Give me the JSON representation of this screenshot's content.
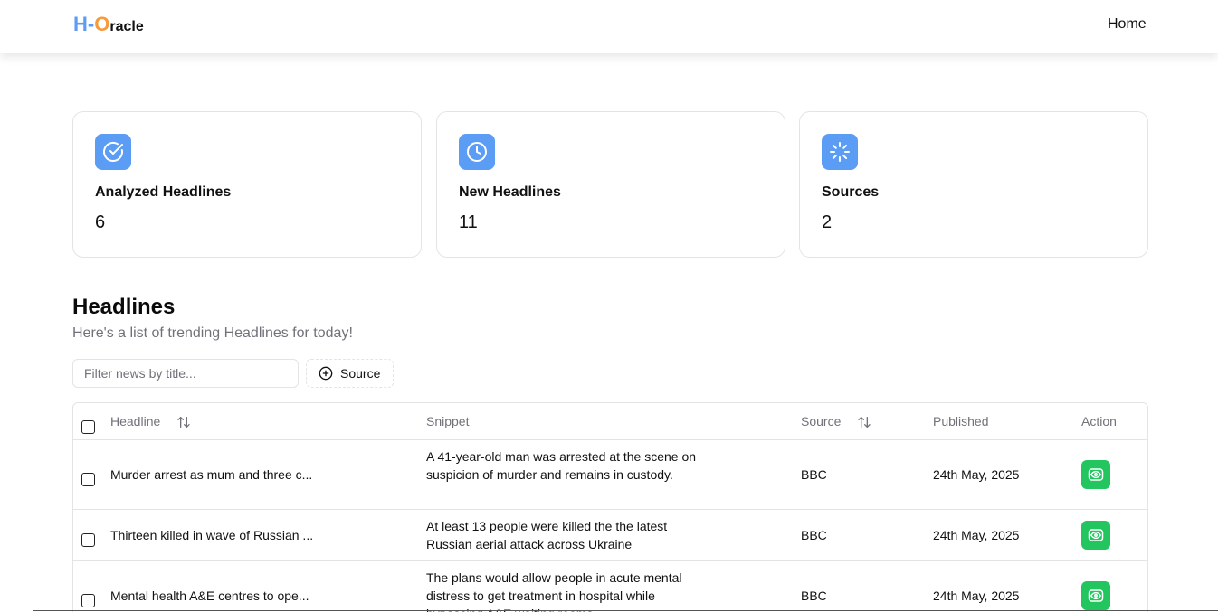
{
  "navbar": {
    "logo": {
      "part1": "H-",
      "part2": "O",
      "part3": "racle"
    },
    "home_label": "Home"
  },
  "stats": [
    {
      "title": "Analyzed Headlines",
      "value": "6",
      "icon": "check-circle-icon"
    },
    {
      "title": "New Headlines",
      "value": "11",
      "icon": "clock-icon"
    },
    {
      "title": "Sources",
      "value": "2",
      "icon": "loader-icon"
    }
  ],
  "headlines_section": {
    "title": "Headlines",
    "subtitle": "Here's a list of trending Headlines for today!",
    "filter_placeholder": "Filter news by title...",
    "source_button_label": "Source"
  },
  "table": {
    "columns": {
      "headline": "Headline",
      "snippet": "Snippet",
      "source": "Source",
      "published": "Published",
      "action": "Action"
    },
    "rows": [
      {
        "headline": "Murder arrest as mum and three c...",
        "snippet": "A 41-year-old man was arrested at the scene on suspicion of murder and remains in custody.",
        "source": "BBC",
        "published": "24th May, 2025"
      },
      {
        "headline": "Thirteen killed in wave of Russian ...",
        "snippet": "At least 13 people were killed the the latest Russian aerial attack across Ukraine",
        "source": "BBC",
        "published": "24th May, 2025"
      },
      {
        "headline": "Mental health A&E centres to ope...",
        "snippet": "The plans would allow people in acute mental distress to get treatment in hospital while bypassing A&E waiting rooms.",
        "source": "BBC",
        "published": "24th May, 2025"
      }
    ]
  },
  "colors": {
    "accent_blue": "#5b9cf5",
    "logo_orange": "#f59b3b",
    "action_green": "#22c55e"
  }
}
